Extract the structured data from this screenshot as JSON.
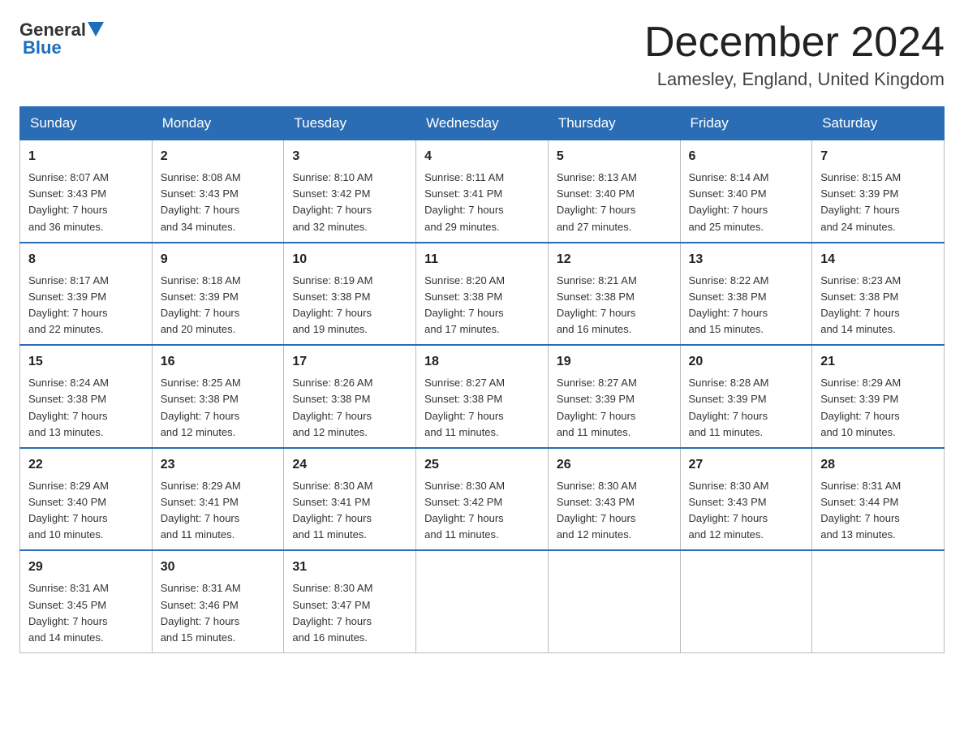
{
  "header": {
    "logo": {
      "general": "General",
      "blue": "Blue"
    },
    "title": "December 2024",
    "location": "Lamesley, England, United Kingdom"
  },
  "weekdays": [
    "Sunday",
    "Monday",
    "Tuesday",
    "Wednesday",
    "Thursday",
    "Friday",
    "Saturday"
  ],
  "weeks": [
    [
      {
        "day": "1",
        "sunrise": "8:07 AM",
        "sunset": "3:43 PM",
        "daylight": "7 hours and 36 minutes."
      },
      {
        "day": "2",
        "sunrise": "8:08 AM",
        "sunset": "3:43 PM",
        "daylight": "7 hours and 34 minutes."
      },
      {
        "day": "3",
        "sunrise": "8:10 AM",
        "sunset": "3:42 PM",
        "daylight": "7 hours and 32 minutes."
      },
      {
        "day": "4",
        "sunrise": "8:11 AM",
        "sunset": "3:41 PM",
        "daylight": "7 hours and 29 minutes."
      },
      {
        "day": "5",
        "sunrise": "8:13 AM",
        "sunset": "3:40 PM",
        "daylight": "7 hours and 27 minutes."
      },
      {
        "day": "6",
        "sunrise": "8:14 AM",
        "sunset": "3:40 PM",
        "daylight": "7 hours and 25 minutes."
      },
      {
        "day": "7",
        "sunrise": "8:15 AM",
        "sunset": "3:39 PM",
        "daylight": "7 hours and 24 minutes."
      }
    ],
    [
      {
        "day": "8",
        "sunrise": "8:17 AM",
        "sunset": "3:39 PM",
        "daylight": "7 hours and 22 minutes."
      },
      {
        "day": "9",
        "sunrise": "8:18 AM",
        "sunset": "3:39 PM",
        "daylight": "7 hours and 20 minutes."
      },
      {
        "day": "10",
        "sunrise": "8:19 AM",
        "sunset": "3:38 PM",
        "daylight": "7 hours and 19 minutes."
      },
      {
        "day": "11",
        "sunrise": "8:20 AM",
        "sunset": "3:38 PM",
        "daylight": "7 hours and 17 minutes."
      },
      {
        "day": "12",
        "sunrise": "8:21 AM",
        "sunset": "3:38 PM",
        "daylight": "7 hours and 16 minutes."
      },
      {
        "day": "13",
        "sunrise": "8:22 AM",
        "sunset": "3:38 PM",
        "daylight": "7 hours and 15 minutes."
      },
      {
        "day": "14",
        "sunrise": "8:23 AM",
        "sunset": "3:38 PM",
        "daylight": "7 hours and 14 minutes."
      }
    ],
    [
      {
        "day": "15",
        "sunrise": "8:24 AM",
        "sunset": "3:38 PM",
        "daylight": "7 hours and 13 minutes."
      },
      {
        "day": "16",
        "sunrise": "8:25 AM",
        "sunset": "3:38 PM",
        "daylight": "7 hours and 12 minutes."
      },
      {
        "day": "17",
        "sunrise": "8:26 AM",
        "sunset": "3:38 PM",
        "daylight": "7 hours and 12 minutes."
      },
      {
        "day": "18",
        "sunrise": "8:27 AM",
        "sunset": "3:38 PM",
        "daylight": "7 hours and 11 minutes."
      },
      {
        "day": "19",
        "sunrise": "8:27 AM",
        "sunset": "3:39 PM",
        "daylight": "7 hours and 11 minutes."
      },
      {
        "day": "20",
        "sunrise": "8:28 AM",
        "sunset": "3:39 PM",
        "daylight": "7 hours and 11 minutes."
      },
      {
        "day": "21",
        "sunrise": "8:29 AM",
        "sunset": "3:39 PM",
        "daylight": "7 hours and 10 minutes."
      }
    ],
    [
      {
        "day": "22",
        "sunrise": "8:29 AM",
        "sunset": "3:40 PM",
        "daylight": "7 hours and 10 minutes."
      },
      {
        "day": "23",
        "sunrise": "8:29 AM",
        "sunset": "3:41 PM",
        "daylight": "7 hours and 11 minutes."
      },
      {
        "day": "24",
        "sunrise": "8:30 AM",
        "sunset": "3:41 PM",
        "daylight": "7 hours and 11 minutes."
      },
      {
        "day": "25",
        "sunrise": "8:30 AM",
        "sunset": "3:42 PM",
        "daylight": "7 hours and 11 minutes."
      },
      {
        "day": "26",
        "sunrise": "8:30 AM",
        "sunset": "3:43 PM",
        "daylight": "7 hours and 12 minutes."
      },
      {
        "day": "27",
        "sunrise": "8:30 AM",
        "sunset": "3:43 PM",
        "daylight": "7 hours and 12 minutes."
      },
      {
        "day": "28",
        "sunrise": "8:31 AM",
        "sunset": "3:44 PM",
        "daylight": "7 hours and 13 minutes."
      }
    ],
    [
      {
        "day": "29",
        "sunrise": "8:31 AM",
        "sunset": "3:45 PM",
        "daylight": "7 hours and 14 minutes."
      },
      {
        "day": "30",
        "sunrise": "8:31 AM",
        "sunset": "3:46 PM",
        "daylight": "7 hours and 15 minutes."
      },
      {
        "day": "31",
        "sunrise": "8:30 AM",
        "sunset": "3:47 PM",
        "daylight": "7 hours and 16 minutes."
      },
      null,
      null,
      null,
      null
    ]
  ],
  "labels": {
    "sunrise": "Sunrise:",
    "sunset": "Sunset:",
    "daylight": "Daylight:"
  }
}
